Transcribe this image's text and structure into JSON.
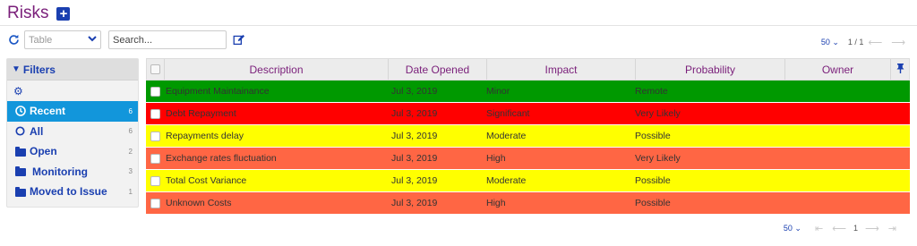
{
  "header": {
    "title": "Risks",
    "add_icon": "plus-square-icon"
  },
  "toolbar": {
    "view_value": "Table",
    "search_placeholder": "Search..."
  },
  "pager_top": {
    "page_size": "50 ⌄",
    "page_info": "1 / 1"
  },
  "pager_bottom": {
    "page_size": "50 ⌄",
    "page_number": "1"
  },
  "filters": {
    "title": "Filters",
    "items": [
      {
        "label": "Recent",
        "count": "6",
        "icon": "clock-icon",
        "active": true
      },
      {
        "label": "All",
        "count": "6",
        "icon": "circle-icon",
        "active": false
      },
      {
        "label": "Open",
        "count": "2",
        "icon": "folder-icon",
        "active": false
      },
      {
        "label": "Monitoring",
        "count": "3",
        "icon": "folder-icon",
        "active": false
      },
      {
        "label": "Moved to Issue",
        "count": "1",
        "icon": "folder-icon",
        "active": false
      }
    ]
  },
  "grid": {
    "columns": [
      "Description",
      "Date Opened",
      "Impact",
      "Probability",
      "Owner"
    ],
    "rows": [
      {
        "description": "Equipment Maintainance",
        "date": "Jul 3, 2019",
        "impact": "Minor",
        "probability": "Remote",
        "owner": "",
        "color": "#009900"
      },
      {
        "description": "Debt Repayment",
        "date": "Jul 3, 2019",
        "impact": "Significant",
        "probability": "Very Likely",
        "owner": "",
        "color": "#ff0000"
      },
      {
        "description": "Repayments delay",
        "date": "Jul 3, 2019",
        "impact": "Moderate",
        "probability": "Possible",
        "owner": "",
        "color": "#ffff00"
      },
      {
        "description": "Exchange rates fluctuation",
        "date": "Jul 3, 2019",
        "impact": "High",
        "probability": "Very Likely",
        "owner": "",
        "color": "#ff6644"
      },
      {
        "description": "Total Cost Variance",
        "date": "Jul 3, 2019",
        "impact": "Moderate",
        "probability": "Possible",
        "owner": "",
        "color": "#ffff00"
      },
      {
        "description": "Unknown Costs",
        "date": "Jul 3, 2019",
        "impact": "High",
        "probability": "Possible",
        "owner": "",
        "color": "#ff6644"
      }
    ]
  },
  "colors": {
    "accent": "#1a3fb0",
    "title": "#7a1f7a",
    "active_filter": "#1296db"
  }
}
